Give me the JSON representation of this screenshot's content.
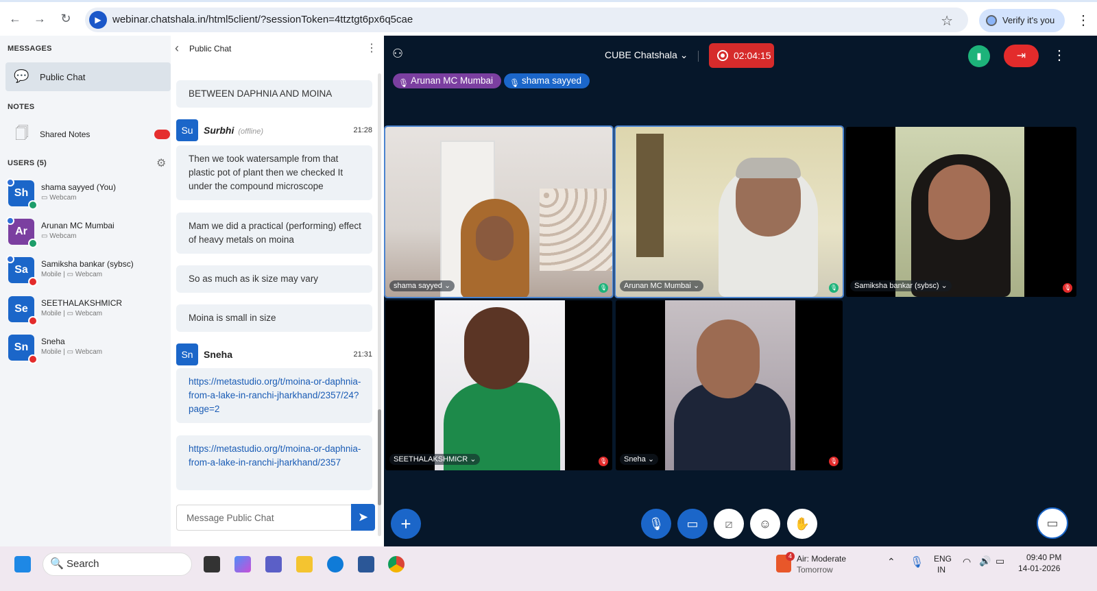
{
  "browser": {
    "url": "webinar.chatshala.in/html5client/?sessionToken=4ttztgt6px6q5cae",
    "verify_label": "Verify it's you",
    "site_icon": "video-camera-icon"
  },
  "sidebar": {
    "messages_label": "MESSAGES",
    "public_chat_label": "Public Chat",
    "notes_label": "NOTES",
    "shared_notes_label": "Shared Notes",
    "users_label": "USERS (5)",
    "users": [
      {
        "initials": "Sh",
        "name": "shama sayyed (You)",
        "sub": "▭ Webcam",
        "color": "#1b66c9",
        "status": "#1e9e6a"
      },
      {
        "initials": "Ar",
        "name": "Arunan MC Mumbai",
        "sub": "▭ Webcam",
        "color": "#7b3fa0",
        "status": "#1e9e6a"
      },
      {
        "initials": "Sa",
        "name": "Samiksha bankar (sybsc)",
        "sub": "Mobile | ▭ Webcam",
        "color": "#1b66c9",
        "status": "#e32b2b"
      },
      {
        "initials": "Se",
        "name": "SEETHALAKSHMICR",
        "sub": "Mobile | ▭ Webcam",
        "color": "#1b66c9",
        "status": "#e32b2b"
      },
      {
        "initials": "Sn",
        "name": "Sneha",
        "sub": "Mobile | ▭ Webcam",
        "color": "#1b66c9",
        "status": "#e32b2b"
      }
    ]
  },
  "chat": {
    "title": "Public Chat",
    "messages": [
      {
        "text": "BETWEEN DAPHNIA AND MOINA"
      },
      {
        "text": "Then we took watersample from that plastic pot of plant then we checked  It under the compound microscope"
      },
      {
        "text": "Mam  we did a practical (performing) effect of heavy metals on moina"
      },
      {
        "text": "So as much as ik size may vary"
      },
      {
        "text": "Moina is small in size"
      },
      {
        "text": "https://metastudio.org/t/moina-or-daphnia-from-a-lake-in-ranchi-jharkhand/2357/24?page=2"
      },
      {
        "text": "https://metastudio.org/t/moina-or-daphnia-from-a-lake-in-ranchi-jharkhand/2357"
      }
    ],
    "senders": [
      {
        "initials": "Su",
        "name": "Surbhi",
        "status": "(offline)",
        "time": "21:28"
      },
      {
        "initials": "Sn",
        "name": "Sneha",
        "status": "",
        "time": "21:31"
      }
    ],
    "input_placeholder": "Message Public Chat"
  },
  "meeting": {
    "title": "CUBE Chatshala",
    "recording_time": "02:04:15",
    "talkers": [
      "Arunan MC Mumbai",
      "shama sayyed"
    ],
    "tiles": [
      {
        "name": "shama sayyed",
        "muted": false
      },
      {
        "name": "Arunan MC Mumbai",
        "muted": false
      },
      {
        "name": "Samiksha bankar (sybsc)",
        "muted": true
      },
      {
        "name": "SEETHALAKSHMICR",
        "muted": true
      },
      {
        "name": "Sneha",
        "muted": true
      }
    ]
  },
  "taskbar": {
    "search_label": "Search",
    "weather_label": "Air: Moderate",
    "weather_sub": "Tomorrow",
    "weather_badge": "4",
    "lang": "ENG",
    "region": "IN",
    "time": "09:40 PM",
    "date": "14-01-2026"
  },
  "colors": {
    "accent": "#1b66c9",
    "meeting_bg": "#06172a",
    "danger": "#e32b2b",
    "success": "#1db37a"
  }
}
